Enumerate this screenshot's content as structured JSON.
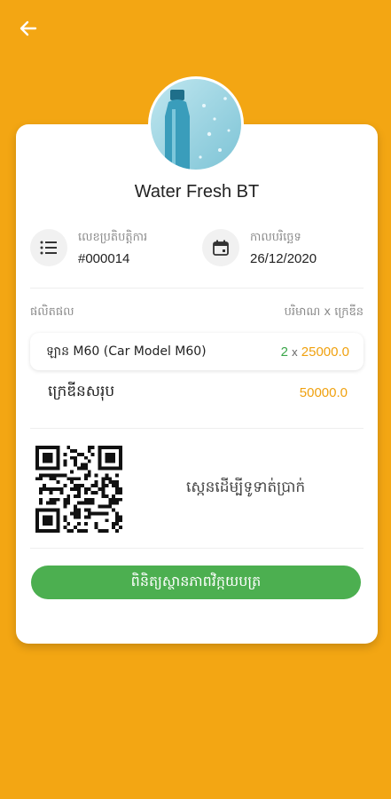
{
  "header": {
    "back_icon": "arrow-left-icon"
  },
  "shop": {
    "name": "Water Fresh BT",
    "avatar_icon": "water-bottle-image"
  },
  "invoice": {
    "number_label": "លេខប្រតិបត្តិការ",
    "number_value": "#000014",
    "date_label": "កាលបរិច្ឆេទ",
    "date_value": "26/12/2020"
  },
  "items_table": {
    "product_header": "ផលិតផល",
    "qty_price_header": "បរិមាណ x ក្រេឌីន",
    "rows": [
      {
        "name": "ឡាន M60 (Car Model M60)",
        "qty": "2",
        "times": "x",
        "price": "25000.0"
      }
    ],
    "total_label": "ក្រេឌីនសរុប",
    "total_value": "50000.0"
  },
  "qr": {
    "caption": "ស្កេនដើម្បីទូទាត់ប្រាក់"
  },
  "actions": {
    "check_status_label": "ពិនិត្យស្ថានភាពវិក្កយបត្រ"
  },
  "colors": {
    "background": "#F3A613",
    "accent_green": "#4CAF50",
    "price_orange": "#F0A10F"
  }
}
